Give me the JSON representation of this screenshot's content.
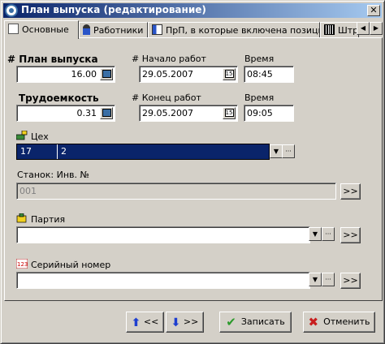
{
  "window": {
    "title": "План выпуска (редактирование)",
    "close_glyph": "✕"
  },
  "tabs": [
    {
      "label": "Основные",
      "icon": "document-icon",
      "active": true
    },
    {
      "label": "Работники",
      "icon": "person-icon",
      "active": false
    },
    {
      "label": "ПрП, в которые включена позиция",
      "icon": "tree-icon",
      "active": false
    },
    {
      "label": "Штр",
      "icon": "barcode-icon",
      "active": false
    }
  ],
  "tab_scroll": {
    "left": "◀",
    "right": "▶"
  },
  "form": {
    "plan_label": "# План выпуска",
    "plan_value": "16.00",
    "labor_label": "Трудоемкость",
    "labor_value": "0.31",
    "start_label": "# Начало работ",
    "start_date": "29.05.2007",
    "start_time_label": "Время",
    "start_time": "08:45",
    "end_label": "# Конец работ",
    "end_date": "29.05.2007",
    "end_time_label": "Время",
    "end_time": "09:05",
    "calendar_glyph": "15",
    "shop_label": "Цех",
    "shop_code": "17",
    "shop_name": "2",
    "machine_label": "Станок: Инв. №",
    "machine_value": "001",
    "batch_label": "Партия",
    "batch_value": "",
    "serial_label": "Серийный номер",
    "serial_value": "",
    "more_glyph": "···",
    "nav_glyph": ">>"
  },
  "buttons": {
    "prev_label": "<<",
    "next_label": ">>",
    "save_label": "Записать",
    "cancel_label": "Отменить"
  },
  "colors": {
    "titlebar_start": "#0a246a",
    "titlebar_end": "#a6caf0",
    "selection": "#0a246a",
    "face": "#d4d0c8"
  }
}
